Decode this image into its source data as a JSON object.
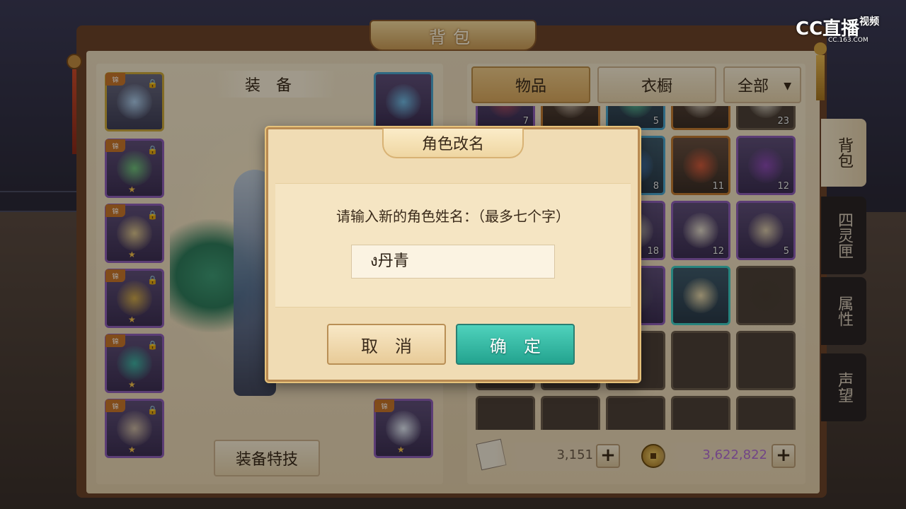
{
  "panel": {
    "title": "背包",
    "equip_label": "装备",
    "equip_skill_button": "装备特技",
    "equip_slots_left": [
      {
        "tag": "锦",
        "rarity": "gold",
        "locked": true,
        "stars": 0
      },
      {
        "tag": "锦",
        "rarity": "purple",
        "locked": true,
        "stars": 1
      },
      {
        "tag": "锦",
        "rarity": "purple",
        "locked": true,
        "stars": 1
      },
      {
        "tag": "锦",
        "rarity": "purple",
        "locked": true,
        "stars": 1
      },
      {
        "tag": "锦",
        "rarity": "purple",
        "locked": true,
        "stars": 1
      },
      {
        "tag": "锦",
        "rarity": "purple",
        "locked": true,
        "stars": 1
      }
    ],
    "equip_slots_right": [
      {
        "tag": "",
        "rarity": "blue",
        "locked": false
      },
      {
        "tag": "锦",
        "rarity": "purple",
        "locked": false
      }
    ]
  },
  "tabs": {
    "items": "物品",
    "wardrobe": "衣橱",
    "filter": "全部"
  },
  "inventory": [
    {
      "count": "7",
      "rarity": "purple"
    },
    {
      "count": "",
      "rarity": "orange"
    },
    {
      "count": "5",
      "rarity": "blue"
    },
    {
      "count": "",
      "rarity": "orange"
    },
    {
      "count": "23",
      "rarity": "empty"
    },
    {
      "count": "",
      "rarity": "purple"
    },
    {
      "count": "",
      "rarity": "purple"
    },
    {
      "count": "8",
      "rarity": "blue"
    },
    {
      "count": "11",
      "rarity": "orange"
    },
    {
      "count": "12",
      "rarity": "purple"
    },
    {
      "count": "",
      "rarity": "purple"
    },
    {
      "count": "",
      "rarity": "purple"
    },
    {
      "count": "18",
      "rarity": "purple"
    },
    {
      "count": "12",
      "rarity": "purple"
    },
    {
      "count": "5",
      "rarity": "purple"
    },
    {
      "count": "",
      "rarity": "purple"
    },
    {
      "count": "",
      "rarity": "purple"
    },
    {
      "count": "",
      "rarity": "purple"
    },
    {
      "count": "",
      "rarity": "teal"
    },
    {
      "count": "",
      "rarity": "empty"
    }
  ],
  "currency": {
    "tickets": "3,151",
    "coins": "3,622,822"
  },
  "side_tabs": [
    {
      "label": "背包",
      "active": true
    },
    {
      "label": "四灵匣",
      "active": false
    },
    {
      "label": "属性",
      "active": false
    },
    {
      "label": "声望",
      "active": false
    }
  ],
  "dialog": {
    "title": "角色改名",
    "prompt": "请输入新的角色姓名：（最多七个字）",
    "input_value": "ง丹青",
    "cancel_label": "取消",
    "confirm_label": "确定"
  },
  "watermark": {
    "brand": "CC直播",
    "sub_brand": "视频",
    "domain": "CC.163.COM"
  },
  "colors": {
    "confirm": "#23a38f",
    "frame": "#6b4228",
    "parchment": "#f0dcb4"
  }
}
